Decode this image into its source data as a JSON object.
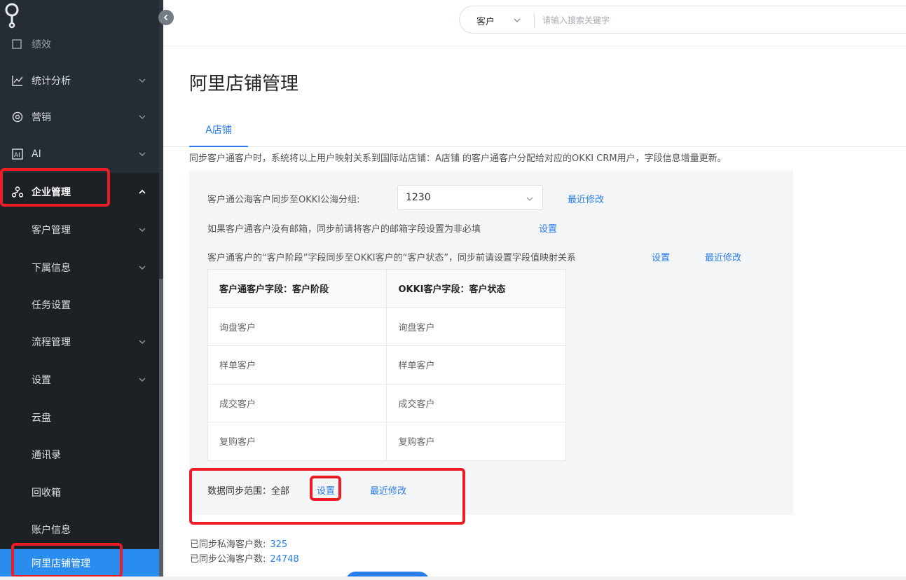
{
  "sidebar": {
    "partial_label": "绩效",
    "items": [
      {
        "label": "统计分析",
        "icon": "line-chart-icon"
      },
      {
        "label": "营销",
        "icon": "target-icon"
      },
      {
        "label": "AI",
        "icon": "ai-icon"
      },
      {
        "label": "企业管理",
        "icon": "org-chart-icon"
      },
      {
        "label": "客户管理"
      },
      {
        "label": "下属信息"
      },
      {
        "label": "任务设置"
      },
      {
        "label": "流程管理"
      },
      {
        "label": "设置"
      },
      {
        "label": "云盘"
      },
      {
        "label": "通讯录"
      },
      {
        "label": "回收箱"
      },
      {
        "label": "账户信息"
      },
      {
        "label": "阿里店铺管理"
      }
    ]
  },
  "header": {
    "search_type": "客户",
    "search_placeholder": "请输入搜索关键字"
  },
  "main": {
    "title": "阿里店铺管理",
    "tab": "A店铺",
    "description": "同步客户通客户时，系统将以上用户映射关系到国际站店铺：A店铺 的客户通客户分配给对应的OKKI CRM用户，字段信息增量更新。",
    "row1_label": "客户通公海客户同步至OKKI公海分组:",
    "row1_value": "1230",
    "row1_link": "最近修改",
    "row2_text": "如果客户通客户没有邮箱，同步前请将客户的邮箱字段设置为非必填",
    "row2_link": "设置",
    "row3_text": "客户通客户的“客户阶段”字段同步至OKKI客户的“客户状态”，同步前请设置字段值映射关系",
    "row3_link1": "设置",
    "row3_link2": "最近修改",
    "table": {
      "headers": [
        "客户通客户字段：客户阶段",
        "OKKI客户字段：客户状态"
      ],
      "rows": [
        [
          "询盘客户",
          "询盘客户"
        ],
        [
          "样单客户",
          "样单客户"
        ],
        [
          "成交客户",
          "成交客户"
        ],
        [
          "复购客户",
          "复购客户"
        ]
      ]
    },
    "sync_range_label": "数据同步范围：全部",
    "sync_range_link": "设置",
    "sync_range_recent": "最近修改",
    "stats": [
      {
        "label": "已同步私海客户数:",
        "value": "325"
      },
      {
        "label": "已同步公海客户数:",
        "value": "24748"
      }
    ]
  },
  "colors": {
    "sidebar_bg": "#262c34",
    "accent": "#2b7de9",
    "highlight": "#ee1c25"
  }
}
